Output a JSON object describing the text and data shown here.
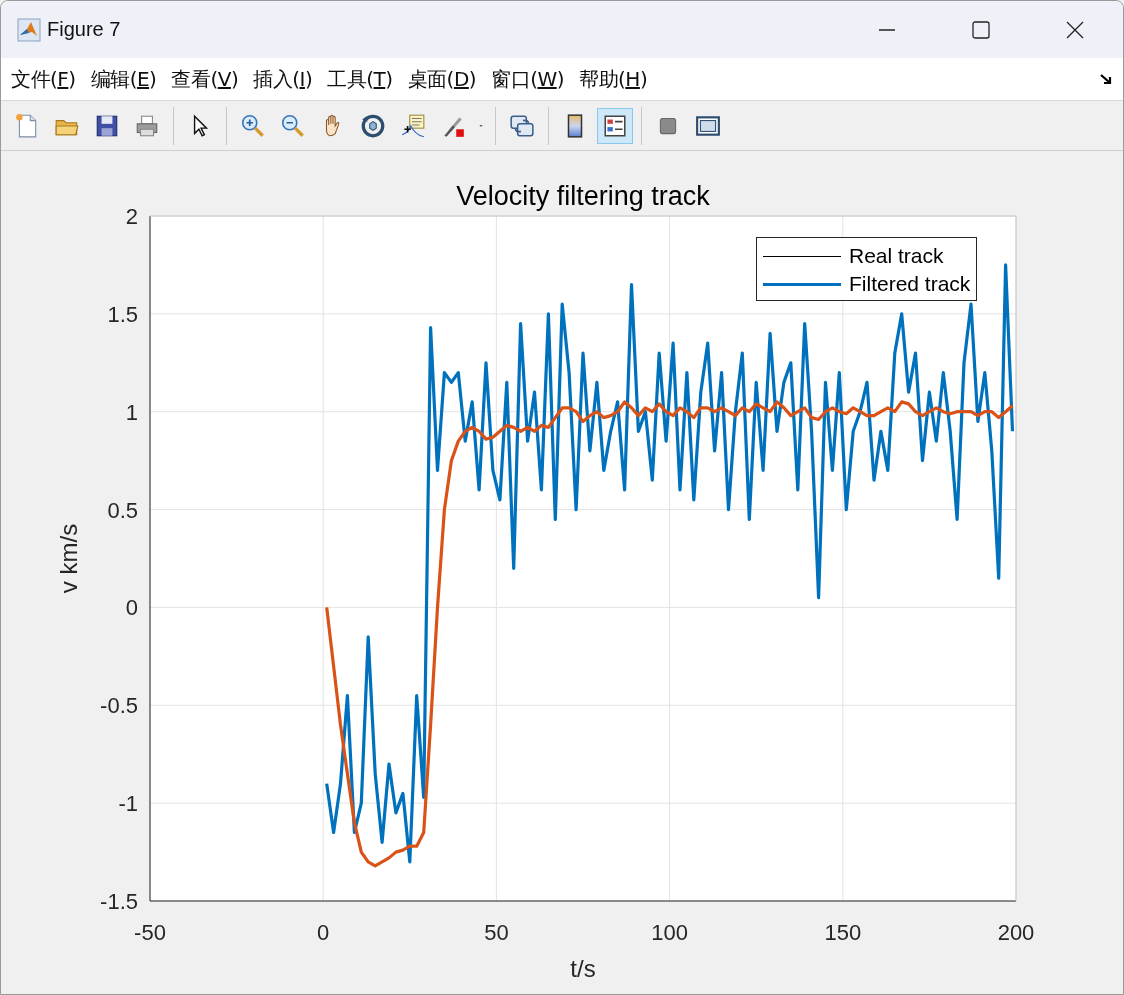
{
  "window": {
    "title": "Figure 7"
  },
  "menu": [
    {
      "before": "文件(",
      "key": "F",
      "after": ")"
    },
    {
      "before": "编辑(",
      "key": "E",
      "after": ")"
    },
    {
      "before": "查看(",
      "key": "V",
      "after": ")"
    },
    {
      "before": "插入(",
      "key": "I",
      "after": ")"
    },
    {
      "before": "工具(",
      "key": "T",
      "after": ")"
    },
    {
      "before": "桌面(",
      "key": "D",
      "after": ")"
    },
    {
      "before": "窗口(",
      "key": "W",
      "after": ")"
    },
    {
      "before": "帮助(",
      "key": "H",
      "after": ")"
    }
  ],
  "toolbar": [
    {
      "kind": "new",
      "selected": false
    },
    {
      "kind": "open",
      "selected": false
    },
    {
      "kind": "save",
      "selected": false
    },
    {
      "kind": "print",
      "selected": false
    },
    {
      "kind": "separator"
    },
    {
      "kind": "pointer",
      "selected": false
    },
    {
      "kind": "separator"
    },
    {
      "kind": "zoom-in",
      "selected": false
    },
    {
      "kind": "zoom-out",
      "selected": false
    },
    {
      "kind": "pan",
      "selected": false
    },
    {
      "kind": "rotate",
      "selected": false
    },
    {
      "kind": "data-cursor",
      "selected": false
    },
    {
      "kind": "brush",
      "selected": false
    },
    {
      "kind": "dropdown"
    },
    {
      "kind": "separator"
    },
    {
      "kind": "link",
      "selected": false
    },
    {
      "kind": "separator"
    },
    {
      "kind": "colorbar",
      "selected": false
    },
    {
      "kind": "legend",
      "selected": true
    },
    {
      "kind": "separator"
    },
    {
      "kind": "hide",
      "selected": false
    },
    {
      "kind": "dock",
      "selected": false
    }
  ],
  "plot": {
    "legend": [
      {
        "label": "Real track",
        "color": "#000000",
        "kind": "thin"
      },
      {
        "label": "Filtered track",
        "color": "#0072bd",
        "kind": "thick"
      }
    ],
    "chart_data": {
      "type": "line",
      "grid": true,
      "title": "Velocity filtering track",
      "xlabel": "t/s",
      "ylabel": "v km/s",
      "xlim": [
        -50,
        200
      ],
      "ylim": [
        -1.5,
        2
      ],
      "xticks": [
        -50,
        0,
        50,
        100,
        150,
        200
      ],
      "yticks": [
        -1.5,
        -1,
        -0.5,
        0,
        0.5,
        1,
        1.5,
        2
      ],
      "x": [
        1,
        3,
        5,
        7,
        9,
        11,
        13,
        15,
        17,
        19,
        21,
        23,
        25,
        27,
        29,
        31,
        33,
        35,
        37,
        39,
        41,
        43,
        45,
        47,
        49,
        51,
        53,
        55,
        57,
        59,
        61,
        63,
        65,
        67,
        69,
        71,
        73,
        75,
        77,
        79,
        81,
        83,
        85,
        87,
        89,
        91,
        93,
        95,
        97,
        99,
        101,
        103,
        105,
        107,
        109,
        111,
        113,
        115,
        117,
        119,
        121,
        123,
        125,
        127,
        129,
        131,
        133,
        135,
        137,
        139,
        141,
        143,
        145,
        147,
        149,
        151,
        153,
        155,
        157,
        159,
        161,
        163,
        165,
        167,
        169,
        171,
        173,
        175,
        177,
        179,
        181,
        183,
        185,
        187,
        189,
        191,
        193,
        195,
        197,
        199
      ],
      "series": [
        {
          "color": "#0072bd",
          "values": [
            -0.9,
            -1.15,
            -0.9,
            -0.45,
            -1.15,
            -1.0,
            -0.15,
            -0.85,
            -1.2,
            -0.8,
            -1.05,
            -0.95,
            -1.3,
            -0.45,
            -0.97,
            1.43,
            0.7,
            1.2,
            1.15,
            1.2,
            0.85,
            1.05,
            0.6,
            1.25,
            0.7,
            0.55,
            1.15,
            0.2,
            1.45,
            0.85,
            1.1,
            0.6,
            1.5,
            0.45,
            1.55,
            1.2,
            0.5,
            1.3,
            0.8,
            1.15,
            0.7,
            0.9,
            1.05,
            0.6,
            1.65,
            0.9,
            1.0,
            0.65,
            1.3,
            0.85,
            1.35,
            0.6,
            1.2,
            0.55,
            1.1,
            1.35,
            0.8,
            1.2,
            0.5,
            1.0,
            1.3,
            0.45,
            1.15,
            0.7,
            1.4,
            0.9,
            1.15,
            1.25,
            0.6,
            1.45,
            0.9,
            0.05,
            1.15,
            0.7,
            1.2,
            0.5,
            0.9,
            1.0,
            1.15,
            0.65,
            0.9,
            0.7,
            1.3,
            1.5,
            1.1,
            1.3,
            0.75,
            1.1,
            0.85,
            1.2,
            0.9,
            0.45,
            1.25,
            1.55,
            0.95,
            1.2,
            0.8,
            0.15,
            1.75,
            0.9
          ]
        },
        {
          "color": "#d95319",
          "values": [
            0,
            -0.3,
            -0.6,
            -0.85,
            -1.1,
            -1.25,
            -1.3,
            -1.32,
            -1.3,
            -1.28,
            -1.25,
            -1.24,
            -1.22,
            -1.22,
            -1.15,
            -0.6,
            0.0,
            0.5,
            0.75,
            0.85,
            0.9,
            0.92,
            0.9,
            0.86,
            0.87,
            0.9,
            0.93,
            0.92,
            0.9,
            0.92,
            0.9,
            0.93,
            0.92,
            0.97,
            1.02,
            1.02,
            1.0,
            0.95,
            0.98,
            1.0,
            0.97,
            0.98,
            1.0,
            1.05,
            1.02,
            0.98,
            1.02,
            1.0,
            1.04,
            1.0,
            0.98,
            1.02,
            1.0,
            0.97,
            1.02,
            1.02,
            1.0,
            1.02,
            1.0,
            0.98,
            1.02,
            1.0,
            1.04,
            1.02,
            1.0,
            1.05,
            1.02,
            0.98,
            1.0,
            1.02,
            0.97,
            0.96,
            1.0,
            1.02,
            1.0,
            0.99,
            1.02,
            1.0,
            0.98,
            0.98,
            1.0,
            1.02,
            1.0,
            1.05,
            1.04,
            1.0,
            0.98,
            1.0,
            1.02,
            1.0,
            0.99,
            1.0,
            1.0,
            1.0,
            0.98,
            1.0,
            1.0,
            0.97,
            1.0,
            1.03
          ]
        }
      ]
    }
  }
}
